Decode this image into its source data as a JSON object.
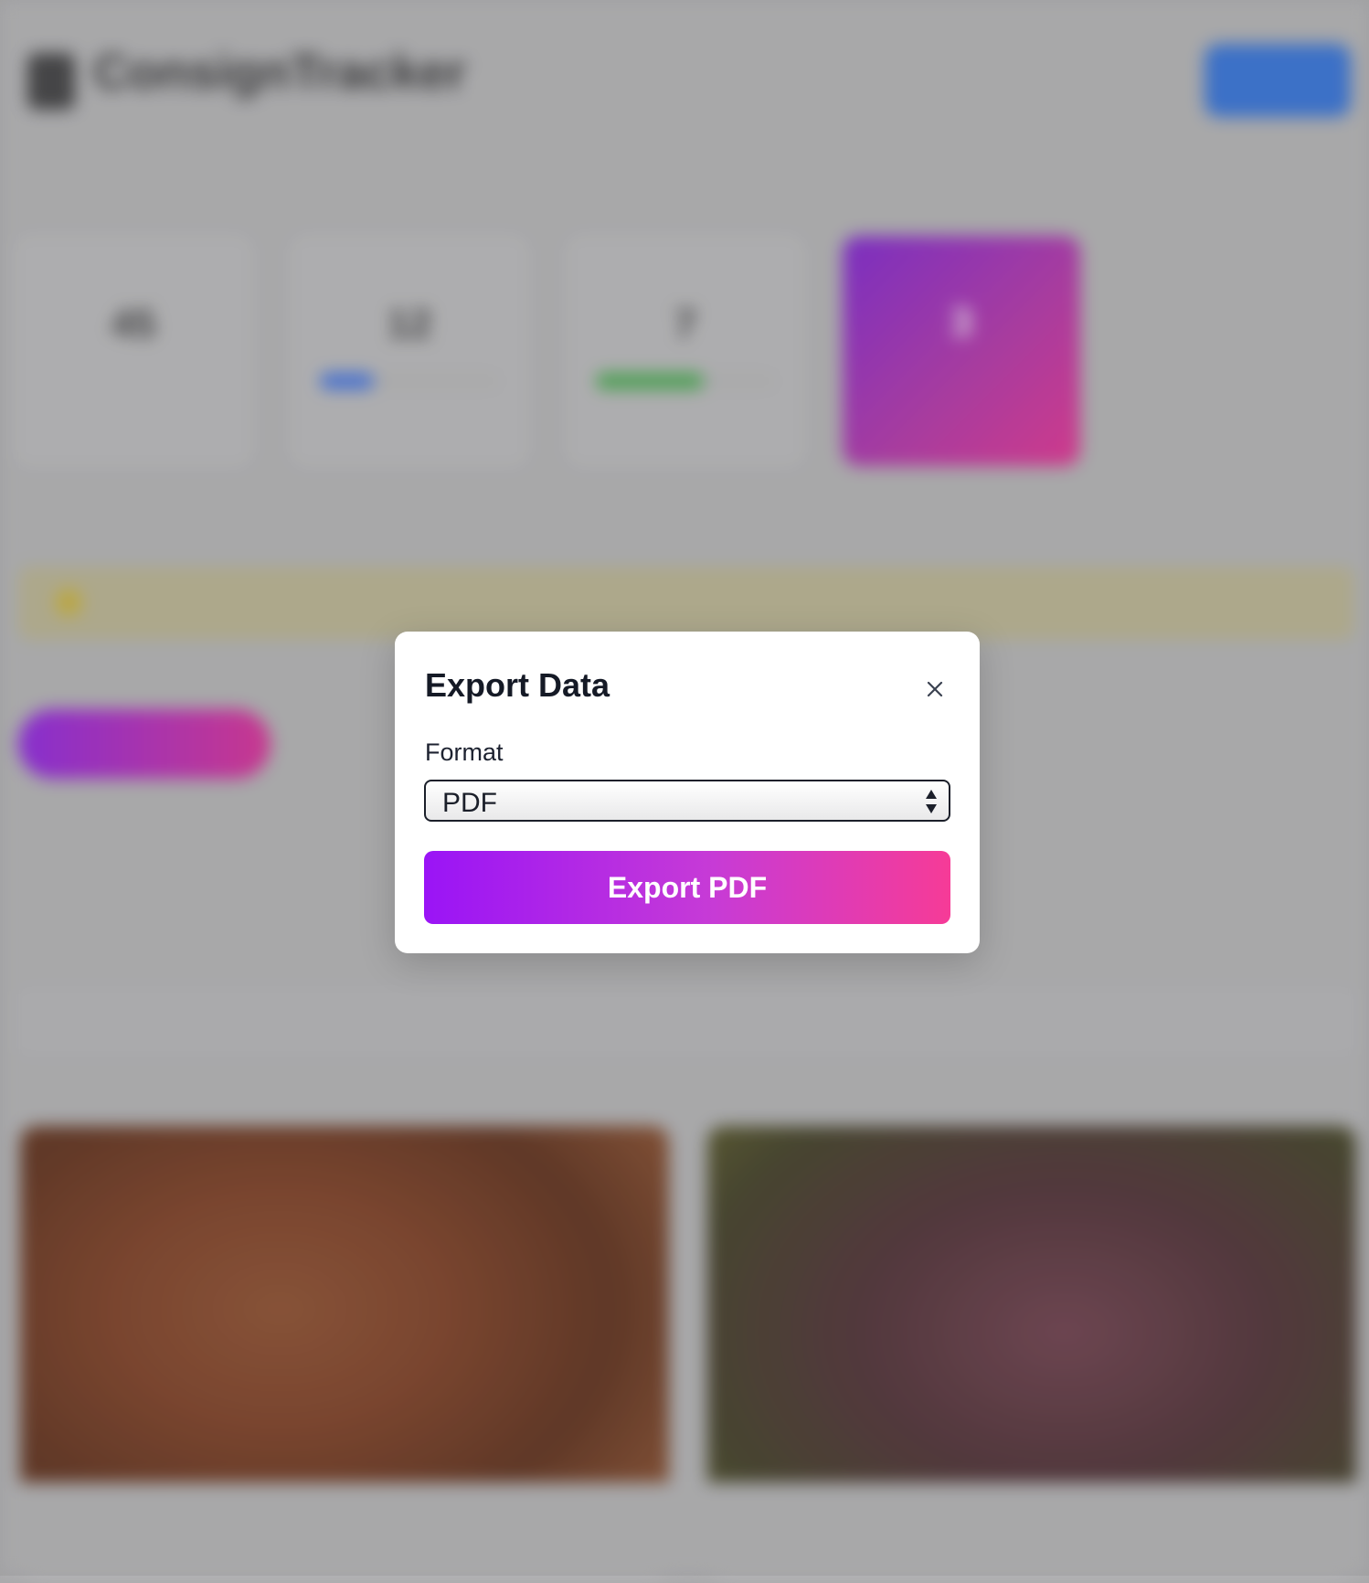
{
  "background": {
    "brand": "ConsignTracker",
    "subtitle": "",
    "stats": [
      {
        "label": "",
        "value": "45",
        "progress": null
      },
      {
        "label": "",
        "value": "12",
        "progress": 0.3
      },
      {
        "label": "",
        "value": "7",
        "progress": 0.6
      },
      {
        "label": "",
        "value": "3",
        "progress": null
      }
    ],
    "colors": {
      "accent_blue": "#2f6fd8",
      "progress_blue": "#2f6fd8",
      "progress_green": "#3fa64a",
      "gradient_start": "#9a14f6",
      "gradient_end": "#f63b97"
    }
  },
  "modal": {
    "title": "Export Data",
    "close_icon": "close-icon",
    "format_label": "Format",
    "format_value": "PDF",
    "format_options_visible": [
      "PDF"
    ],
    "export_button": "Export PDF"
  }
}
